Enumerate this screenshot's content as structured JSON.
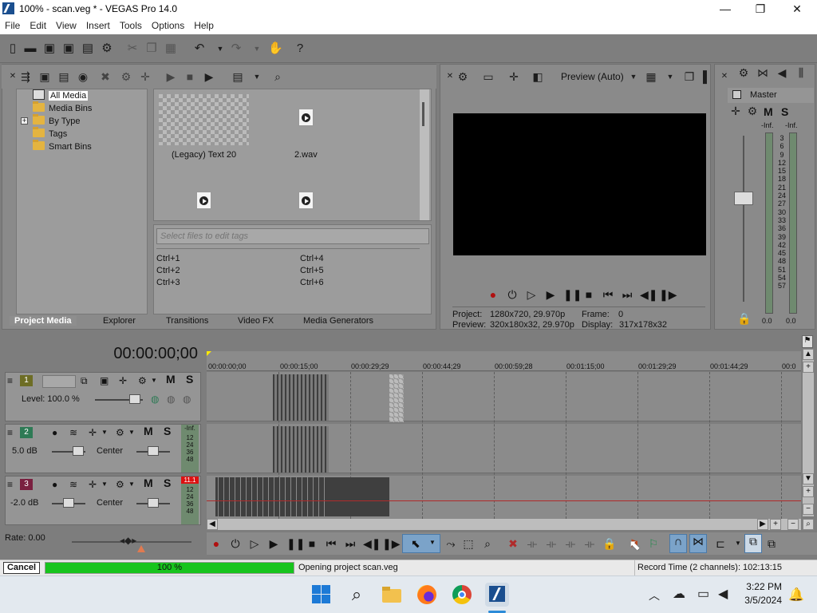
{
  "window": {
    "title": "100% - scan.veg * - VEGAS Pro 14.0",
    "minimize": "—",
    "maximize": "❐",
    "close": "✕"
  },
  "menu": [
    "File",
    "Edit",
    "View",
    "Insert",
    "Tools",
    "Options",
    "Help"
  ],
  "media_tree": {
    "items": [
      {
        "label": "All Media",
        "selected": true
      },
      {
        "label": "Media Bins"
      },
      {
        "label": "By Type",
        "expander": "+"
      },
      {
        "label": "Tags"
      },
      {
        "label": "Smart Bins"
      }
    ]
  },
  "media_items": [
    {
      "label": "(Legacy) Text 20",
      "kind": "generated-text"
    },
    {
      "label": "2.wav",
      "kind": "audio"
    },
    {
      "label": "",
      "kind": "audio"
    },
    {
      "label": "",
      "kind": "audio"
    }
  ],
  "tags": {
    "placeholder": "Select files to edit tags",
    "shortcuts": [
      "Ctrl+1",
      "Ctrl+4",
      "Ctrl+2",
      "Ctrl+5",
      "Ctrl+3",
      "Ctrl+6"
    ]
  },
  "window_tabs": [
    "Project Media",
    "Explorer",
    "Transitions",
    "Video FX",
    "Media Generators"
  ],
  "preview": {
    "mode": "Preview (Auto)",
    "project_label": "Project:",
    "project_value": "1280x720, 29.970p",
    "preview_label": "Preview:",
    "preview_value": "320x180x32, 29.970p",
    "frame_label": "Frame:",
    "frame_value": "0",
    "display_label": "Display:",
    "display_value": "317x178x32"
  },
  "master_bus": {
    "title": "Master",
    "m": "M",
    "s": "S",
    "left_peak": "-Inf.",
    "right_peak": "-Inf.",
    "scale": [
      "3",
      "6",
      "9",
      "12",
      "15",
      "18",
      "21",
      "24",
      "27",
      "30",
      "33",
      "36",
      "39",
      "42",
      "45",
      "48",
      "51",
      "54",
      "57"
    ],
    "left_level": "0.0",
    "right_level": "0.0"
  },
  "timeline": {
    "timecode": "00:00:00;00",
    "ruler": [
      "00:00:00;00",
      "00:00:15;00",
      "00:00:29;29",
      "00:00:44;29",
      "00:00:59;28",
      "00:01:15;00",
      "00:01:29;29",
      "00:01:44;29",
      "00:0"
    ],
    "rate_label": "Rate: 0.00"
  },
  "tracks": [
    {
      "num": "1",
      "type": "video",
      "level": "Level: 100.0 %",
      "m": "M",
      "s": "S",
      "color": "#d8d84a"
    },
    {
      "num": "2",
      "type": "audio",
      "volume": "5.0 dB",
      "pan": "Center",
      "m": "M",
      "s": "S",
      "meter_top": "-Inf.",
      "meter_marks": [
        "12",
        "24",
        "36",
        "48"
      ],
      "color": "#3d9a6e"
    },
    {
      "num": "3",
      "type": "audio",
      "volume": "-2.0 dB",
      "pan": "Center",
      "m": "M",
      "s": "S",
      "meter_top": "11.1",
      "meter_marks": [
        "12",
        "24",
        "36",
        "48"
      ],
      "color": "#a33050"
    }
  ],
  "status": {
    "cancel": "Cancel",
    "progress_text": "100 %",
    "progress": 1.0,
    "message": "Opening project scan.veg",
    "record_time": "Record Time (2 channels): 102:13:15"
  },
  "taskbar": {
    "time": "3:22 PM",
    "date": "3/5/2024"
  },
  "colors": {
    "progress_green": "#17c41d",
    "accent_blue": "#2c8bd8"
  }
}
